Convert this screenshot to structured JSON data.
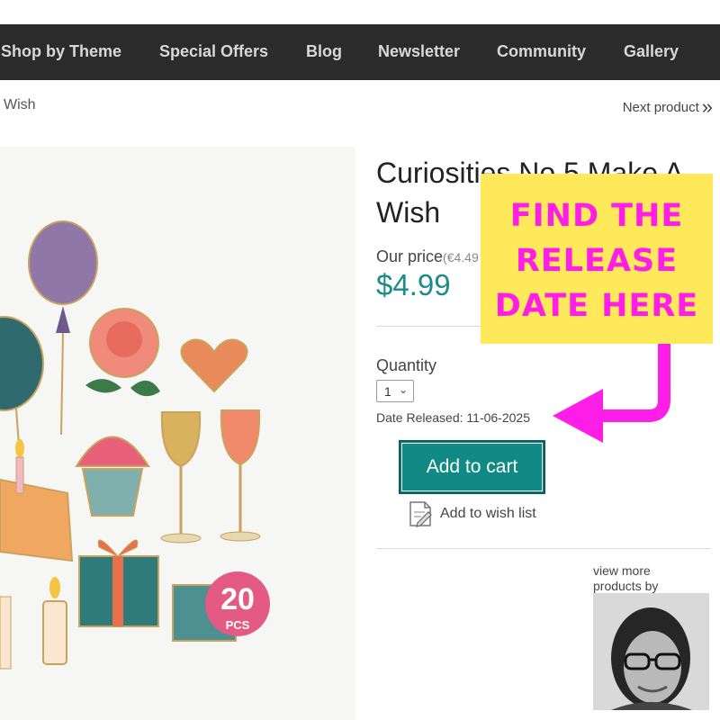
{
  "nav": {
    "items": [
      "Shop by Theme",
      "Special Offers",
      "Blog",
      "Newsletter",
      "Community",
      "Gallery"
    ]
  },
  "breadcrumb": {
    "current": "Wish"
  },
  "pager": {
    "next_label": "Next product",
    "next_icon": "double-chevron-right-icon"
  },
  "product": {
    "title": "Curiosities No 5 Make A Wish",
    "price_label": "Our price",
    "original_price": "(€4.49",
    "price": "$4.99",
    "quantity_label": "Quantity",
    "quantity_value": "1",
    "release_label": "Date Released:",
    "release_date": "11-06-2025",
    "add_to_cart": "Add to cart",
    "add_to_wishlist": "Add to wish list",
    "image_badge_count": "20",
    "image_badge_unit": "PCS"
  },
  "designer": {
    "view_more": "view more products by"
  },
  "callout": {
    "lines": [
      "FIND THE",
      "RELEASE",
      "DATE HERE"
    ],
    "background": "#fde95a",
    "text_color": "#ff1ee8"
  },
  "colors": {
    "navbar": "#2b2b2b",
    "accent": "#118a86",
    "price": "#1d8b8b"
  }
}
